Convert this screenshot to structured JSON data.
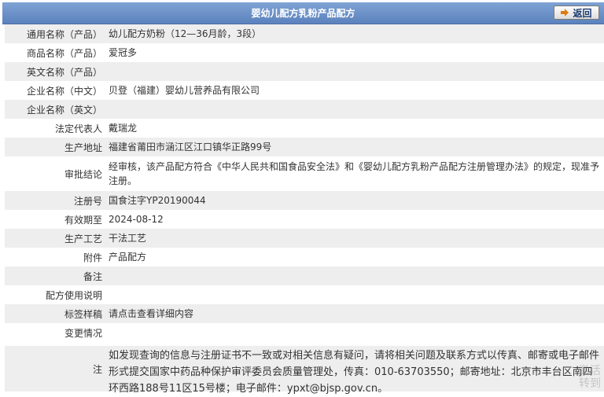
{
  "header": {
    "title": "婴幼儿配方乳粉产品配方",
    "back_label": "返回"
  },
  "rows": [
    {
      "label": "通用名称（产品）",
      "value": "幼儿配方奶粉（12—36月龄，3段）"
    },
    {
      "label": "商品名称（产品）",
      "value": "爱冠多"
    },
    {
      "label": "英文名称（产品）",
      "value": ""
    },
    {
      "label": "企业名称（中文）",
      "value": "贝登（福建）婴幼儿营养品有限公司"
    },
    {
      "label": "企业名称（英文）",
      "value": ""
    },
    {
      "label": "法定代表人",
      "value": "戴瑞龙"
    },
    {
      "label": "生产地址",
      "value": "福建省莆田市涵江区江口镇华正路99号"
    },
    {
      "label": "审批结论",
      "value": "经审核，该产品配方符合《中华人民共和国食品安全法》和《婴幼儿配方乳粉产品配方注册管理办法》的规定，现准予注册。"
    },
    {
      "label": "注册号",
      "value": "国食注字YP20190044"
    },
    {
      "label": "有效期至",
      "value": "2024-08-12"
    },
    {
      "label": "生产工艺",
      "value": "干法工艺"
    },
    {
      "label": "附件",
      "value": "产品配方"
    },
    {
      "label": "备注",
      "value": ""
    },
    {
      "label": "配方使用说明",
      "value": ""
    },
    {
      "label": "标签样稿",
      "value": "请点击查看详细内容"
    },
    {
      "label": "变更情况",
      "value": ""
    }
  ],
  "notice": {
    "label": "注",
    "text": "如发现查询的信息与注册证书不一致或对相关信息有疑问，请将相关问题及联系方式以传真、邮寄或电子邮件形式提交国家中药品种保护审评委员会质量管理处，传真：010-63703550；邮寄地址：北京市丰台区南四环西路188号11区15号楼；电子邮件：ypxt@bjsp.gov.cn。"
  },
  "watermark": {
    "line1": "激活",
    "line2": "转到"
  }
}
